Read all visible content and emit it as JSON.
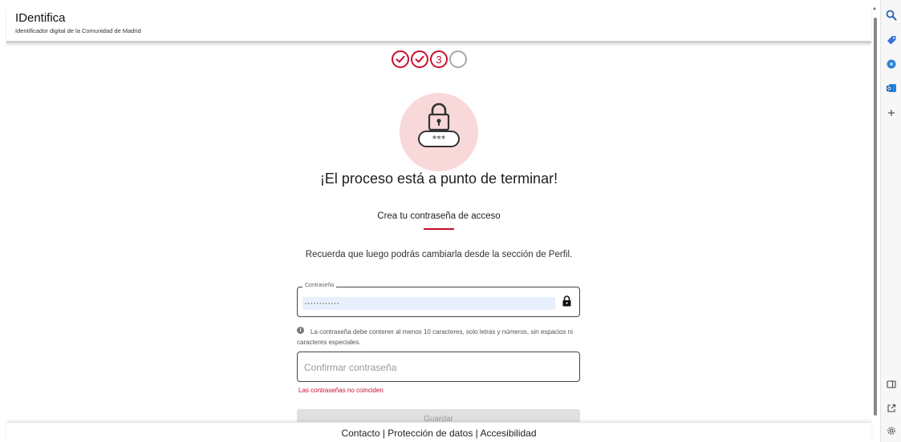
{
  "header": {
    "title": "IDentifica",
    "subtitle": "Identificador digital de la Comunidad de Madrid"
  },
  "progress": {
    "steps": [
      {
        "state": "done"
      },
      {
        "state": "done"
      },
      {
        "state": "current",
        "label": "3"
      },
      {
        "state": "pending"
      }
    ]
  },
  "main": {
    "heading": "¡El proceso está a punto de terminar!",
    "subheading": "Crea tu contraseña de acceso",
    "reminder": "Recuerda que luego podrás cambiarla desde la sección de Perfil.",
    "password_field": {
      "label": "Contraseña",
      "value": "············"
    },
    "info_text": "La contraseña debe contener al menos 10 caracteres, solo letras y números, sin espacios ni caracteres especiales.",
    "confirm_field": {
      "placeholder": "Confirmar contraseña",
      "value": ""
    },
    "error_text": "Las contraseñas no coinciden",
    "save_label": "Guardar"
  },
  "footer": {
    "text": "Contacto | Protección de datos | Accesibilidad"
  },
  "colors": {
    "accent": "#c8102e",
    "lock_bg": "#f8d8d9",
    "autofill_bg": "#e8f0fe"
  },
  "sidebar_icons": [
    "search-icon",
    "tag-icon",
    "copilot-icon",
    "outlook-icon",
    "plus-icon",
    "sidebar-toggle-icon",
    "external-link-icon",
    "settings-icon"
  ]
}
